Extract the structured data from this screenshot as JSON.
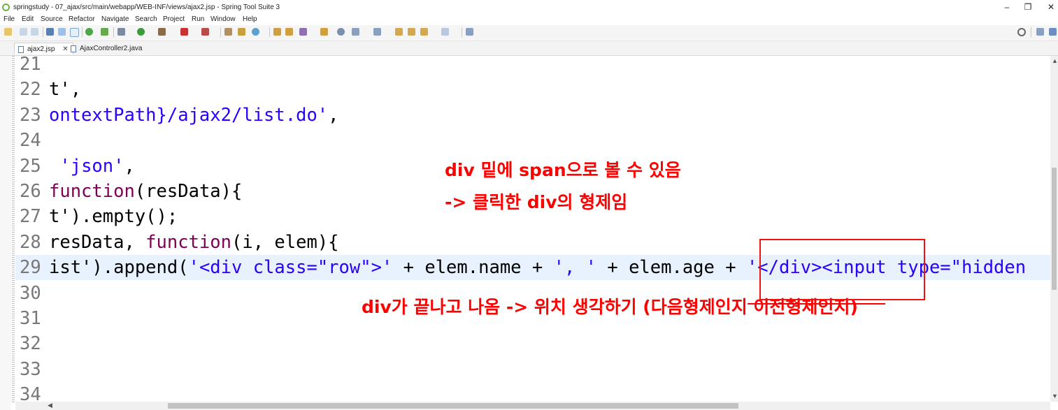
{
  "window": {
    "title": "springstudy - 07_ajax/src/main/webapp/WEB-INF/views/ajax2.jsp - Spring Tool Suite 3",
    "minimize": "–",
    "maximize": "❐",
    "close": "✕"
  },
  "menu": [
    "File",
    "Edit",
    "Source",
    "Refactor",
    "Navigate",
    "Search",
    "Project",
    "Run",
    "Window",
    "Help"
  ],
  "tabs": [
    {
      "label": "ajax2.jsp",
      "close": "✕"
    },
    {
      "label": "AjaxController2.java"
    }
  ],
  "editor": {
    "lines": [
      {
        "num": "21",
        "parts": []
      },
      {
        "num": "22",
        "parts": [
          {
            "t": "t',",
            "c": ""
          }
        ]
      },
      {
        "num": "23",
        "parts": [
          {
            "t": "ontextPath}/ajax2/list.do'",
            "c": "str"
          },
          {
            "t": ",",
            "c": ""
          }
        ]
      },
      {
        "num": "24",
        "parts": []
      },
      {
        "num": "25",
        "parts": [
          {
            "t": " ",
            "c": ""
          },
          {
            "t": "'json'",
            "c": "str"
          },
          {
            "t": ",",
            "c": ""
          }
        ]
      },
      {
        "num": "26",
        "parts": [
          {
            "t": "function",
            "c": "kw"
          },
          {
            "t": "(resData){",
            "c": ""
          }
        ]
      },
      {
        "num": "27",
        "parts": [
          {
            "t": "t').empty();",
            "c": ""
          }
        ]
      },
      {
        "num": "28",
        "parts": [
          {
            "t": "resData, ",
            "c": ""
          },
          {
            "t": "function",
            "c": "kw"
          },
          {
            "t": "(i, elem){",
            "c": ""
          }
        ]
      },
      {
        "num": "29",
        "current": true,
        "parts": [
          {
            "t": "ist').append(",
            "c": ""
          },
          {
            "t": "'<div class=\"row\">'",
            "c": "str"
          },
          {
            "t": " + elem.name + ",
            "c": ""
          },
          {
            "t": "', '",
            "c": "str"
          },
          {
            "t": " + elem.age + ",
            "c": ""
          },
          {
            "t": "'</div><input type=\"hidden",
            "c": "str"
          }
        ]
      },
      {
        "num": "30",
        "parts": []
      },
      {
        "num": "31",
        "parts": []
      },
      {
        "num": "32",
        "parts": []
      },
      {
        "num": "33",
        "parts": []
      },
      {
        "num": "34",
        "parts": []
      }
    ]
  },
  "annotations": {
    "note1_line1": "div 밑에 span으로 볼 수 있음",
    "note1_line2": "-> 클릭한 div의 형제임",
    "note2": "div가 끝나고 나옴 -> 위치 생각하기 (다음형제인지 이전형제인지)"
  },
  "colors": {
    "keyword": "#7f0055",
    "string": "#2a00ff",
    "line_number": "#787878",
    "current_line": "#e8f2fe",
    "annotation": "#ff0000"
  }
}
